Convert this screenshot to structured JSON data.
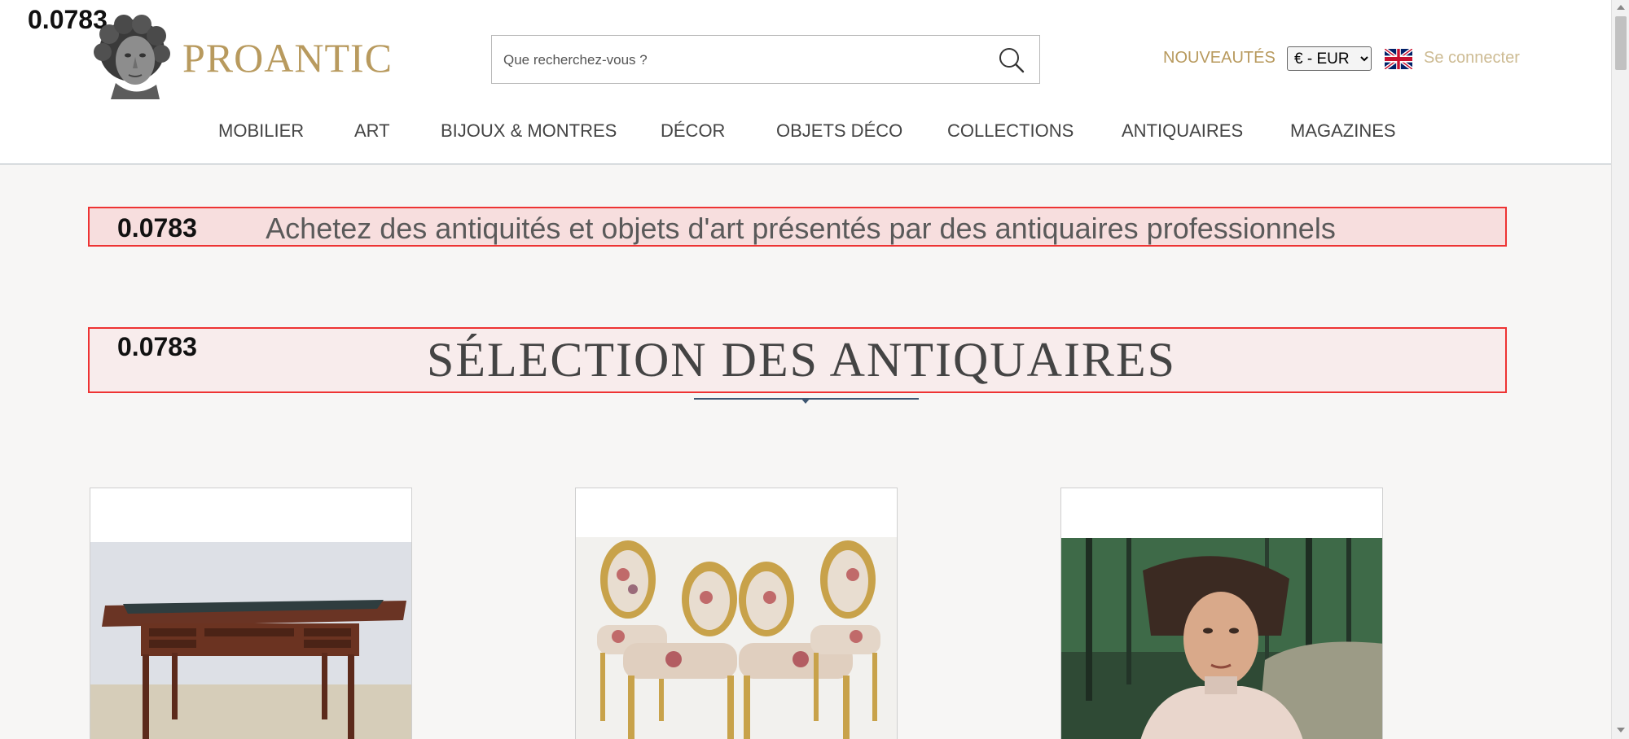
{
  "header": {
    "logo_text": "PROANTIC",
    "search_placeholder": "Que recherchez-vous ?",
    "new_label": "NOUVEAUTÉS",
    "currency_value": "€ - EUR",
    "login_label": "Se connecter",
    "score_badge": "0.0783"
  },
  "nav": {
    "items": [
      "MOBILIER",
      "ART",
      "BIJOUX & MONTRES",
      "DÉCOR",
      "OBJETS DÉCO",
      "COLLECTIONS",
      "ANTIQUAIRES",
      "MAGAZINES"
    ]
  },
  "tagline": {
    "score_badge": "0.0783",
    "text": "Achetez des antiquités et objets d'art présentés par des antiquaires professionnels"
  },
  "section": {
    "score_badge": "0.0783",
    "title": "SÉLECTION DES ANTIQUAIRES"
  },
  "colors": {
    "gold": "#b89a5e",
    "navy": "#3e5772",
    "highlight_border": "#ee3333"
  }
}
